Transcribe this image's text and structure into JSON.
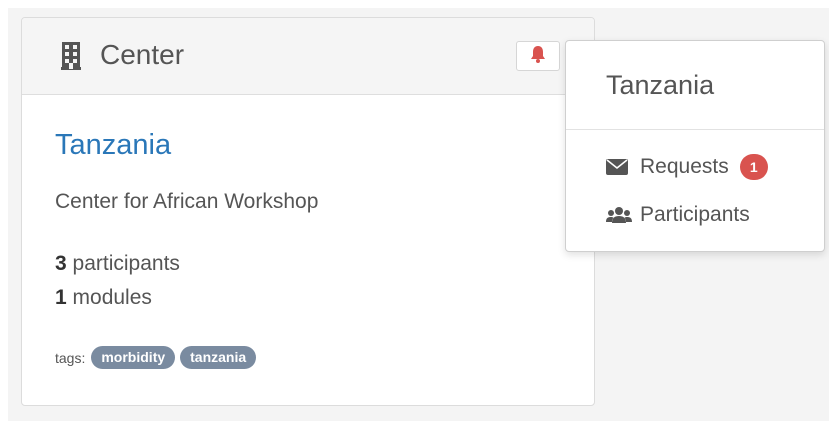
{
  "card": {
    "header_title": "Center",
    "center_name": "Tanzania",
    "description": "Center for African Workshop",
    "stats": [
      {
        "count": "3",
        "label": " participants"
      },
      {
        "count": "1",
        "label": " modules"
      }
    ],
    "tags_label": "tags:",
    "tags": [
      "morbidity",
      "tanzania"
    ]
  },
  "dropdown": {
    "title": "Tanzania",
    "items": [
      {
        "label": "Requests",
        "icon": "envelope-icon",
        "badge": "1"
      },
      {
        "label": "Participants",
        "icon": "users-icon"
      }
    ]
  },
  "colors": {
    "link": "#2a77b8",
    "bell": "#d9534f",
    "badge": "#d9534f",
    "tag": "#7a8ba0"
  }
}
